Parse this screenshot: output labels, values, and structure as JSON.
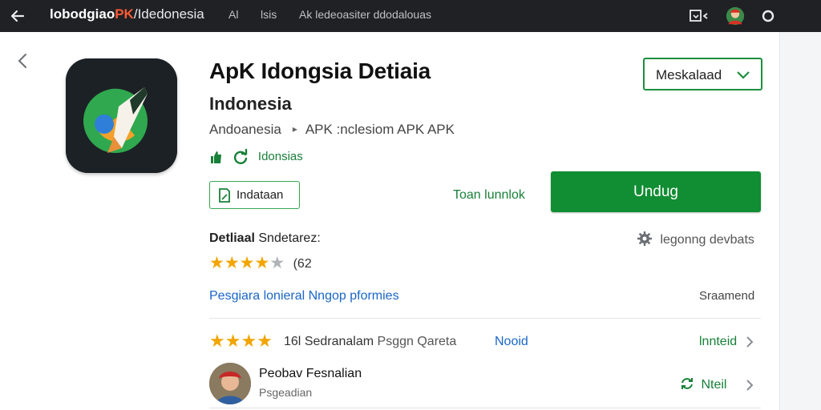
{
  "topbar": {
    "site_name_main": "lobodgiao",
    "site_name_accent": "PK",
    "site_separator": "/",
    "site_region": "Idedonesia",
    "tab_a": "Al",
    "tab_b": "lsis",
    "tab_c": "Ak ledeoasiter ddodalouas",
    "icons": [
      "back-arrow-icon",
      "window-box-icon",
      "avatar-icon",
      "circle-icon"
    ]
  },
  "app": {
    "title": "ApK Idongsia Detiaia",
    "subtitle": "Indonesia",
    "breadcrumb": [
      "Andoanesia",
      "APK :nclesiom APK APK"
    ],
    "meta_label": "Idonsias",
    "variant_dropdown": "Meskalaad",
    "outline_button": "Indataan",
    "more_link": "Toan lunnlok",
    "install_button": "Undug"
  },
  "details": {
    "heading_bold": "Detliaal",
    "heading_rest": "Sndetarez:",
    "settings_link": "legonng devbats",
    "rating_stars": 4,
    "rating_max": 5,
    "rating_count": "(62",
    "blue_link": "Pesgiara lonieral Nngop pformies",
    "right_text": "Sraamend"
  },
  "review": {
    "stars": 4,
    "count_text": "16l",
    "text": "Sedranalam",
    "text_grey": "Psggn Qareta",
    "middle_link": "Nooid",
    "action": "lnnteid"
  },
  "user": {
    "name": "Peobav Fesnalian",
    "sub": "Psgeadian",
    "action": "Nteil"
  },
  "colors": {
    "topbar": "#1f2124",
    "accent_green": "#118d33",
    "link_green": "#188038",
    "link_blue": "#1a66c7",
    "star": "#f2a500"
  }
}
